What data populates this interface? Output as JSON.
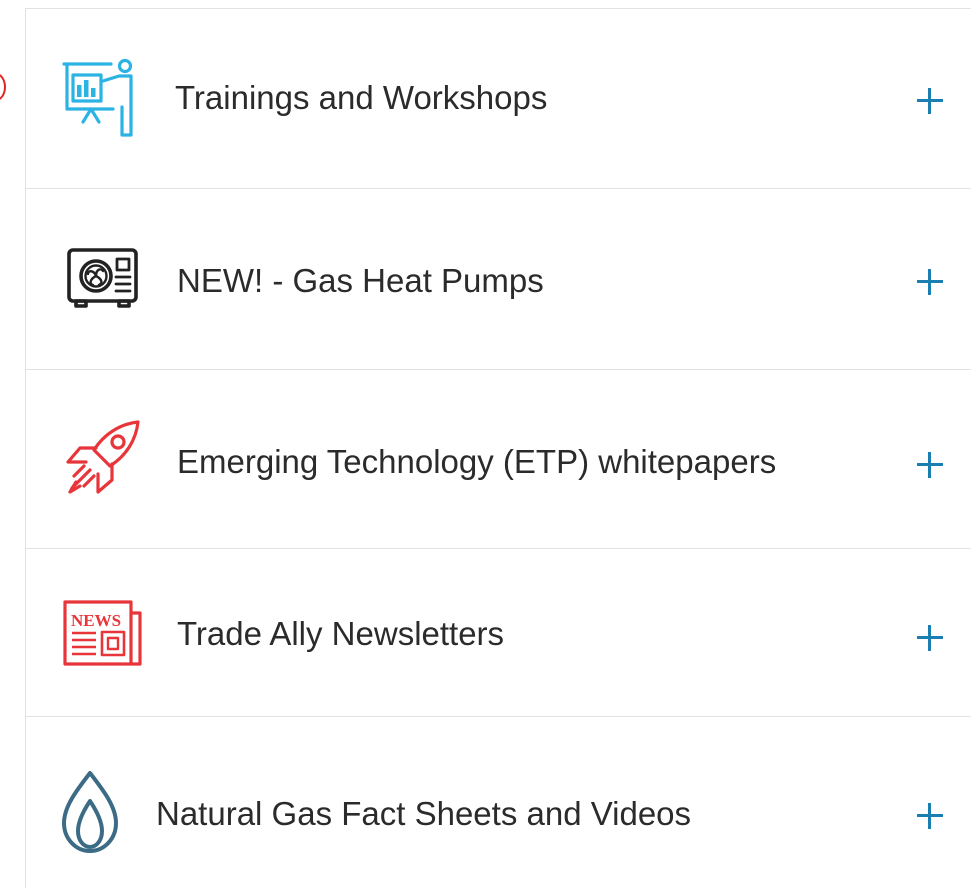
{
  "accordion": {
    "items": [
      {
        "label": "Trainings and Workshops",
        "icon": "presentation-board-icon",
        "icon_color": "#2bb3e3"
      },
      {
        "label": "NEW! - Gas Heat Pumps",
        "icon": "heat-pump-unit-icon",
        "icon_color": "#222222"
      },
      {
        "label": "Emerging Technology (ETP) whitepapers",
        "icon": "rocket-icon",
        "icon_color": "#e8353a"
      },
      {
        "label": "Trade Ally Newsletters",
        "icon": "newspaper-icon",
        "icon_color": "#e8353a",
        "icon_text": "NEWS"
      },
      {
        "label": "Natural Gas Fact Sheets and Videos",
        "icon": "gas-flame-icon",
        "icon_color": "#3c6b85"
      }
    ],
    "expand_symbol": "plus-icon",
    "accent_color": "#1a7fb0"
  }
}
